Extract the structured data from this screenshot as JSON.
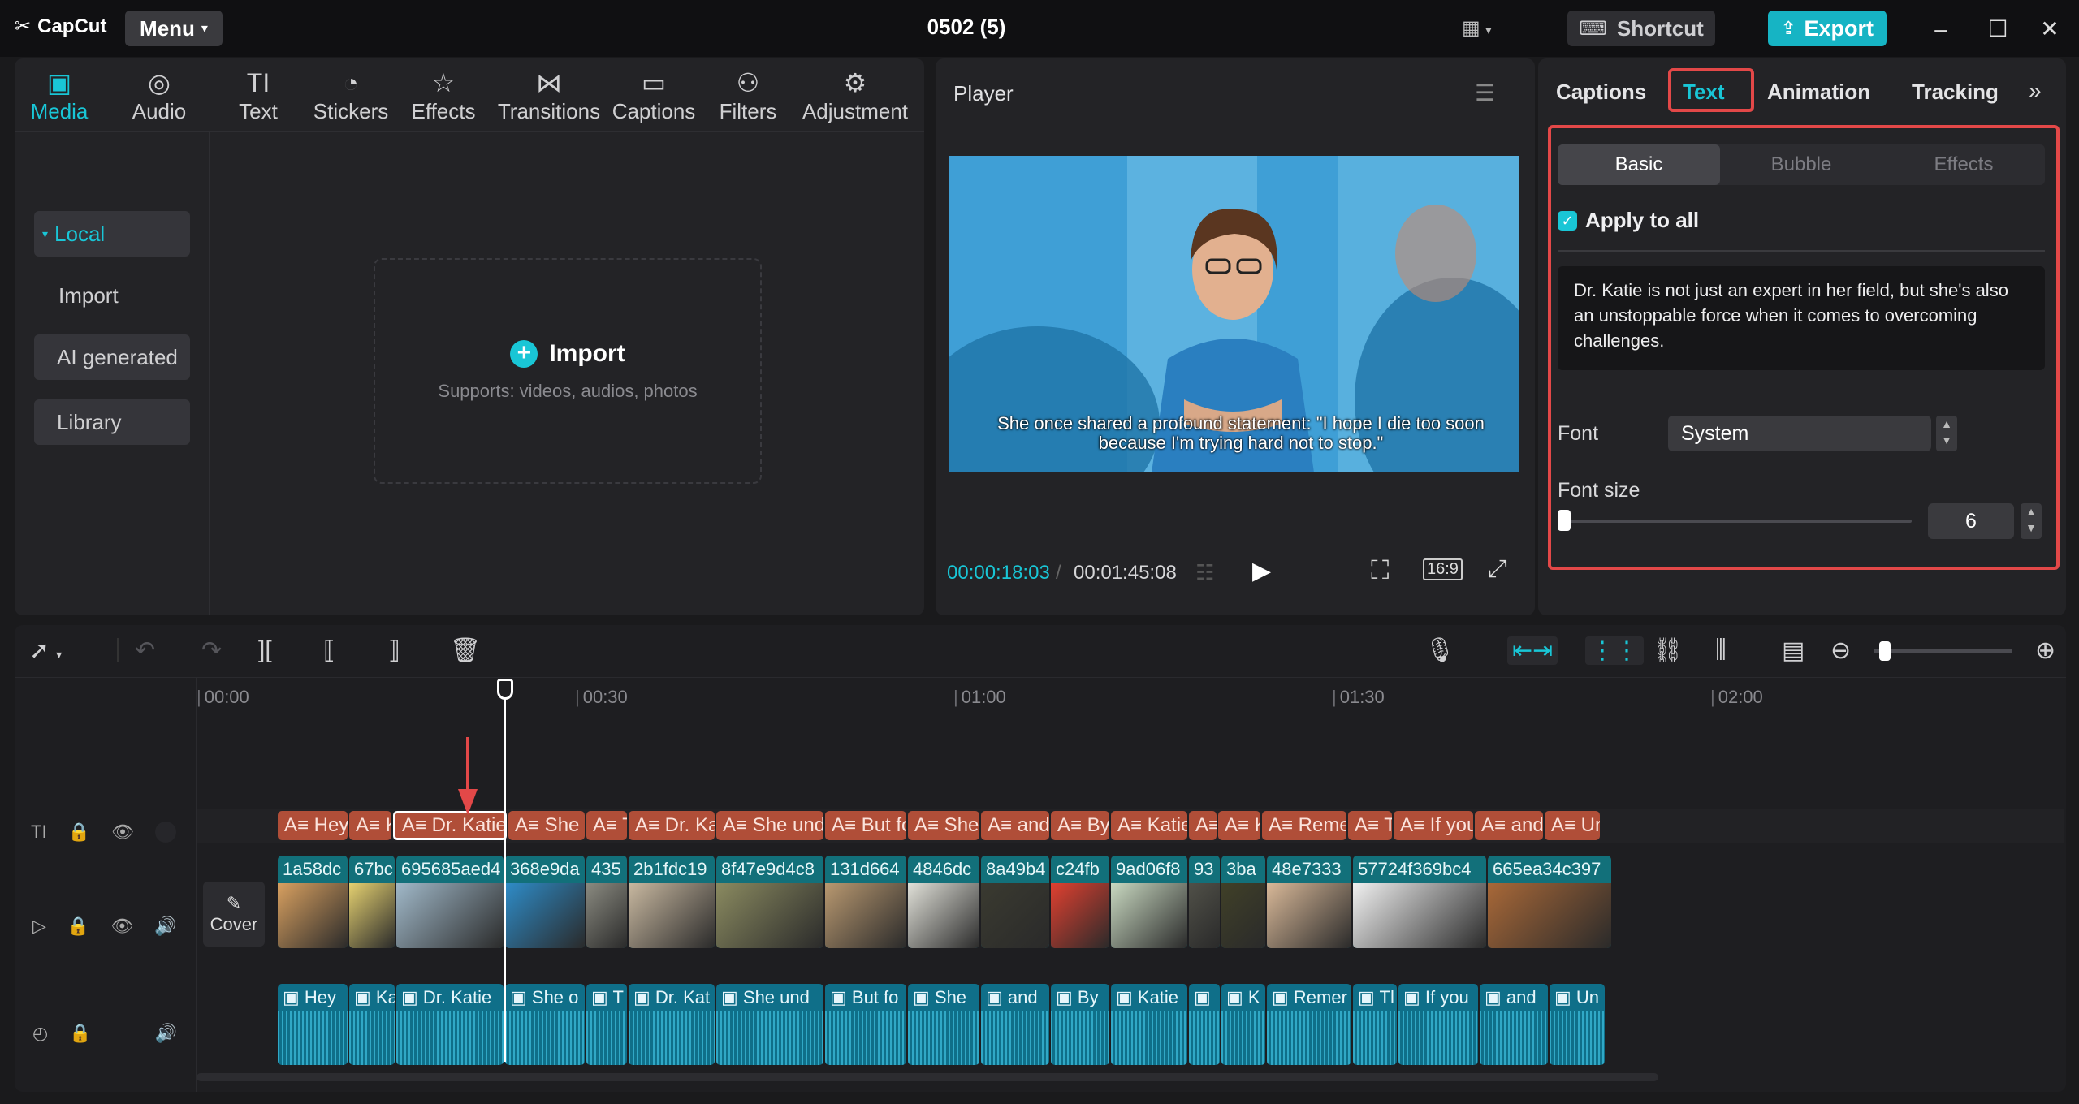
{
  "app": {
    "logo": "CapCut",
    "menu": "Menu",
    "title": "0502 (5)",
    "shortcut": "Shortcut",
    "export": "Export"
  },
  "media_tools": [
    {
      "label": "Media",
      "icon": "media-icon"
    },
    {
      "label": "Audio",
      "icon": "audio-icon"
    },
    {
      "label": "Text",
      "icon": "text-icon"
    },
    {
      "label": "Stickers",
      "icon": "stickers-icon"
    },
    {
      "label": "Effects",
      "icon": "effects-icon"
    },
    {
      "label": "Transitions",
      "icon": "transitions-icon"
    },
    {
      "label": "Captions",
      "icon": "captions-icon"
    },
    {
      "label": "Filters",
      "icon": "filters-icon"
    },
    {
      "label": "Adjustment",
      "icon": "adjustment-icon"
    }
  ],
  "media_side": {
    "local": "Local",
    "import": "Import",
    "ai": "AI generated",
    "library": "Library"
  },
  "import_area": {
    "title": "Import",
    "subtitle": "Supports: videos, audios, photos"
  },
  "player": {
    "title": "Player",
    "subtitle": "She once shared a profound statement: \"I hope I die too soon because I'm trying hard not to stop.\"",
    "time_current": "00:00:18:03",
    "time_total": "00:01:45:08",
    "ratio": "16:9"
  },
  "props": {
    "tabs": [
      "Captions",
      "Text",
      "Animation",
      "Tracking"
    ],
    "segments": [
      "Basic",
      "Bubble",
      "Effects"
    ],
    "apply_all": "Apply to all",
    "text_content": "Dr. Katie is not just an expert in her field, but she's also an unstoppable force when it comes to overcoming challenges.",
    "font_label": "Font",
    "font_value": "System",
    "size_label": "Font size",
    "size_value": "6"
  },
  "timeline": {
    "ruler": [
      "00:00",
      "00:30",
      "01:00",
      "01:30",
      "02:00"
    ],
    "cover": "Cover",
    "text_clips": [
      {
        "t": "A≡ Hey",
        "w": 86
      },
      {
        "t": "A≡ K",
        "w": 52
      },
      {
        "t": "A≡ Dr. Katie",
        "w": 140,
        "sel": true
      },
      {
        "t": "A≡ She c",
        "w": 94
      },
      {
        "t": "A≡ T",
        "w": 50
      },
      {
        "t": "A≡ Dr. Ka",
        "w": 106
      },
      {
        "t": "A≡ She und",
        "w": 132
      },
      {
        "t": "A≡ But fo",
        "w": 100
      },
      {
        "t": "A≡ She",
        "w": 88
      },
      {
        "t": "A≡ and",
        "w": 84
      },
      {
        "t": "A≡ By",
        "w": 72
      },
      {
        "t": "A≡ Katie",
        "w": 94
      },
      {
        "t": "A≡",
        "w": 34
      },
      {
        "t": "A≡ K",
        "w": 52
      },
      {
        "t": "A≡ Reme",
        "w": 104
      },
      {
        "t": "A≡ T",
        "w": 54
      },
      {
        "t": "A≡ If you",
        "w": 98
      },
      {
        "t": "A≡ and",
        "w": 84
      },
      {
        "t": "A≡ Ur",
        "w": 68
      }
    ],
    "video_clips": [
      {
        "t": "1a58dc",
        "w": 86,
        "c": "#d8a060"
      },
      {
        "t": "67bc",
        "w": 56,
        "c": "#e4d070"
      },
      {
        "t": "695685aed4",
        "w": 132,
        "c": "#a0b8c8"
      },
      {
        "t": "368e9da",
        "w": 98,
        "c": "#2e8cc8"
      },
      {
        "t": "435",
        "w": 50,
        "c": "#8a8a80"
      },
      {
        "t": "2b1fdc19",
        "w": 106,
        "c": "#c8b8a0"
      },
      {
        "t": "8f47e9d4c8",
        "w": 132,
        "c": "#8a8a60"
      },
      {
        "t": "131d664",
        "w": 100,
        "c": "#b89870"
      },
      {
        "t": "4846dc",
        "w": 88,
        "c": "#e0e0d8"
      },
      {
        "t": "8a49b4",
        "w": 84,
        "c": "#3a3a30"
      },
      {
        "t": "c24fb",
        "w": 72,
        "c": "#e04030"
      },
      {
        "t": "9ad06f8",
        "w": 94,
        "c": "#c8d8c0"
      },
      {
        "t": "93",
        "w": 38,
        "c": "#505048"
      },
      {
        "t": "3ba",
        "w": 54,
        "c": "#404028"
      },
      {
        "t": "48e7333",
        "w": 104,
        "c": "#d8b898"
      },
      {
        "t": "57724f369bc4",
        "w": 164,
        "c": "#f0f0f0"
      },
      {
        "t": "665ea34c397",
        "w": 152,
        "c": "#a86838"
      }
    ],
    "audio_clips": [
      {
        "t": "▣ Hey",
        "w": 86
      },
      {
        "t": "▣ Ka",
        "w": 56
      },
      {
        "t": "▣ Dr. Katie",
        "w": 132
      },
      {
        "t": "▣ She o",
        "w": 98
      },
      {
        "t": "▣ T",
        "w": 50
      },
      {
        "t": "▣ Dr. Kat",
        "w": 106
      },
      {
        "t": "▣ She und",
        "w": 132
      },
      {
        "t": "▣ But fo",
        "w": 100
      },
      {
        "t": "▣ She",
        "w": 88
      },
      {
        "t": "▣ and",
        "w": 84
      },
      {
        "t": "▣ By",
        "w": 72
      },
      {
        "t": "▣ Katie",
        "w": 94
      },
      {
        "t": "▣",
        "w": 38
      },
      {
        "t": "▣ K",
        "w": 54
      },
      {
        "t": "▣ Remer",
        "w": 104
      },
      {
        "t": "▣ Tl",
        "w": 54
      },
      {
        "t": "▣ If you",
        "w": 98
      },
      {
        "t": "▣ and",
        "w": 84
      },
      {
        "t": "▣ Un",
        "w": 68
      }
    ]
  },
  "colors": {
    "accent": "#19c6d6",
    "highlight": "#e34848",
    "text_clip": "#b04e38",
    "video_clip": "#12707a",
    "audio_clip": "#0f6f89"
  }
}
